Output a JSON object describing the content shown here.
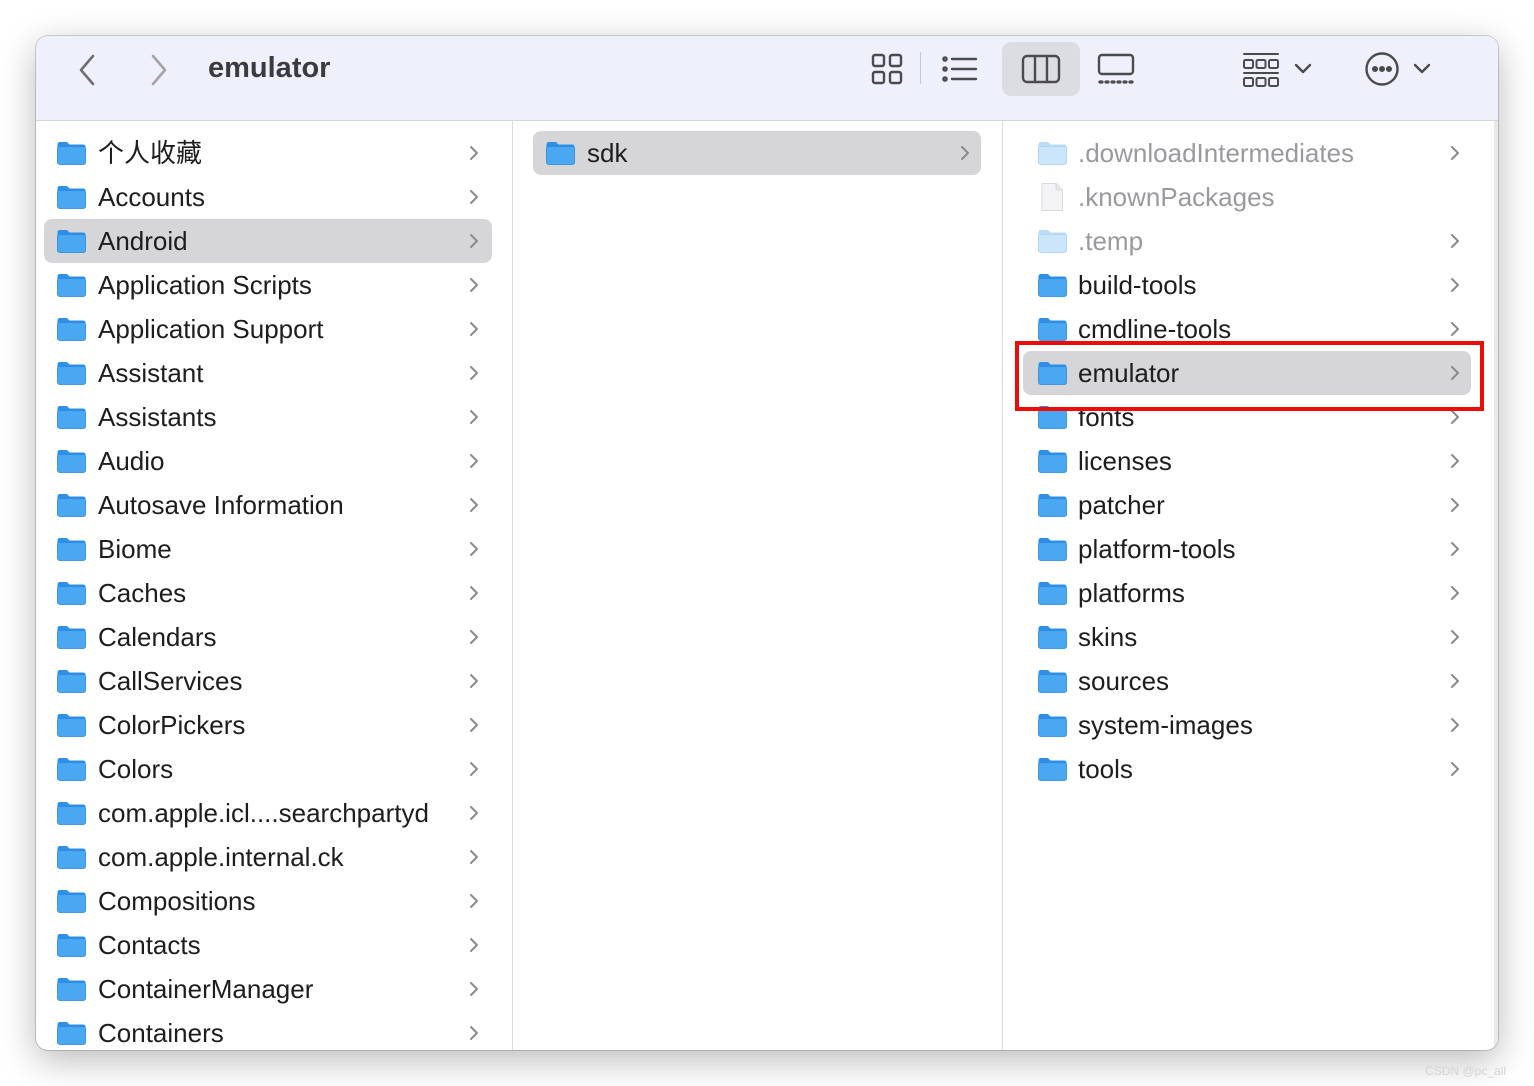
{
  "window": {
    "title": "emulator"
  },
  "toolbar": {
    "back_icon": "chevron-left-icon",
    "forward_icon": "chevron-right-icon",
    "views": [
      {
        "name": "icon-view",
        "icon": "grid-icon",
        "active": false
      },
      {
        "name": "list-view",
        "icon": "list-icon",
        "active": false
      },
      {
        "name": "column-view",
        "icon": "columns-icon",
        "active": true
      },
      {
        "name": "gallery-view",
        "icon": "gallery-icon",
        "active": false
      }
    ],
    "group_icon": "group-grid-icon",
    "more_icon": "ellipsis-circle-icon"
  },
  "columns": [
    {
      "items": [
        {
          "label": "个人收藏",
          "kind": "folder",
          "chevron": true
        },
        {
          "label": "Accounts",
          "kind": "folder",
          "chevron": true
        },
        {
          "label": "Android",
          "kind": "folder",
          "chevron": true,
          "selected": true
        },
        {
          "label": "Application Scripts",
          "kind": "folder",
          "chevron": true
        },
        {
          "label": "Application Support",
          "kind": "folder",
          "chevron": true
        },
        {
          "label": "Assistant",
          "kind": "folder",
          "chevron": true
        },
        {
          "label": "Assistants",
          "kind": "folder",
          "chevron": true
        },
        {
          "label": "Audio",
          "kind": "folder",
          "chevron": true
        },
        {
          "label": "Autosave Information",
          "kind": "folder",
          "chevron": true
        },
        {
          "label": "Biome",
          "kind": "folder",
          "chevron": true
        },
        {
          "label": "Caches",
          "kind": "folder",
          "chevron": true
        },
        {
          "label": "Calendars",
          "kind": "folder",
          "chevron": true
        },
        {
          "label": "CallServices",
          "kind": "folder",
          "chevron": true
        },
        {
          "label": "ColorPickers",
          "kind": "folder",
          "chevron": true
        },
        {
          "label": "Colors",
          "kind": "folder",
          "chevron": true
        },
        {
          "label": "com.apple.icl....searchpartyd",
          "kind": "folder",
          "chevron": true
        },
        {
          "label": "com.apple.internal.ck",
          "kind": "folder",
          "chevron": true
        },
        {
          "label": "Compositions",
          "kind": "folder",
          "chevron": true
        },
        {
          "label": "Contacts",
          "kind": "folder",
          "chevron": true
        },
        {
          "label": "ContainerManager",
          "kind": "folder",
          "chevron": true
        },
        {
          "label": "Containers",
          "kind": "folder",
          "chevron": true
        }
      ]
    },
    {
      "items": [
        {
          "label": "sdk",
          "kind": "folder",
          "chevron": true,
          "selected": true
        }
      ]
    },
    {
      "items": [
        {
          "label": ".downloadIntermediates",
          "kind": "folder",
          "chevron": true,
          "hidden": true
        },
        {
          "label": ".knownPackages",
          "kind": "file",
          "chevron": false,
          "hidden": true
        },
        {
          "label": ".temp",
          "kind": "folder",
          "chevron": true,
          "hidden": true
        },
        {
          "label": "build-tools",
          "kind": "folder",
          "chevron": true
        },
        {
          "label": "cmdline-tools",
          "kind": "folder",
          "chevron": true
        },
        {
          "label": "emulator",
          "kind": "folder",
          "chevron": true,
          "selected": true
        },
        {
          "label": "fonts",
          "kind": "folder",
          "chevron": true
        },
        {
          "label": "licenses",
          "kind": "folder",
          "chevron": true
        },
        {
          "label": "patcher",
          "kind": "folder",
          "chevron": true
        },
        {
          "label": "platform-tools",
          "kind": "folder",
          "chevron": true
        },
        {
          "label": "platforms",
          "kind": "folder",
          "chevron": true
        },
        {
          "label": "skins",
          "kind": "folder",
          "chevron": true
        },
        {
          "label": "sources",
          "kind": "folder",
          "chevron": true
        },
        {
          "label": "system-images",
          "kind": "folder",
          "chevron": true
        },
        {
          "label": "tools",
          "kind": "folder",
          "chevron": true
        }
      ]
    }
  ],
  "annotation": {
    "color": "#ee0b0b",
    "target": "emulator"
  },
  "colors": {
    "folder": "#3a9cf0",
    "selection": "#d6d6d9",
    "toolbar_bg": "#eef1fb"
  },
  "watermark": "CSDN @pc_all"
}
